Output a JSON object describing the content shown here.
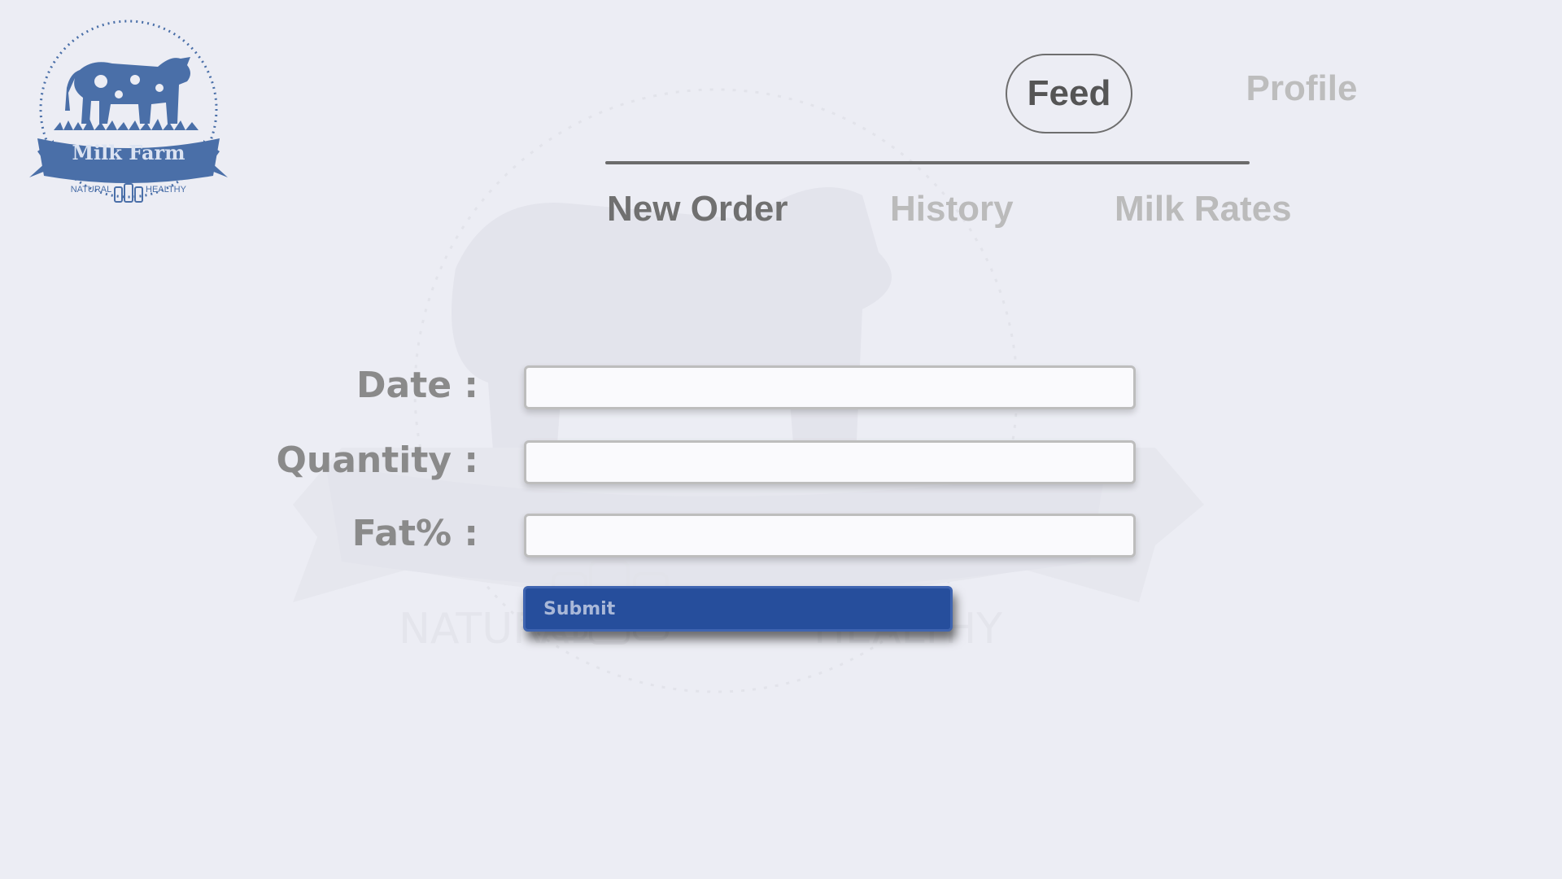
{
  "brand": {
    "name": "Milk Farm",
    "tagline_left": "NATURAL",
    "tagline_right": "HEALTHY",
    "color": "#4a6fa8"
  },
  "top_nav": {
    "items": [
      {
        "label": "Feed",
        "active": true
      },
      {
        "label": "Profile",
        "active": false
      }
    ]
  },
  "sub_nav": {
    "items": [
      {
        "label": "New Order",
        "active": true
      },
      {
        "label": "History",
        "active": false
      },
      {
        "label": "Milk Rates",
        "active": false
      }
    ]
  },
  "form": {
    "date_label": "Date :",
    "date_value": "",
    "quantity_label": "Quantity :",
    "quantity_value": "",
    "fat_label": "Fat% :",
    "fat_value": "",
    "submit_label": "Submit"
  },
  "colors": {
    "background": "#ecedf4",
    "accent": "#264e9c",
    "inactive_text": "#bbbbbb",
    "active_text": "#707070"
  }
}
